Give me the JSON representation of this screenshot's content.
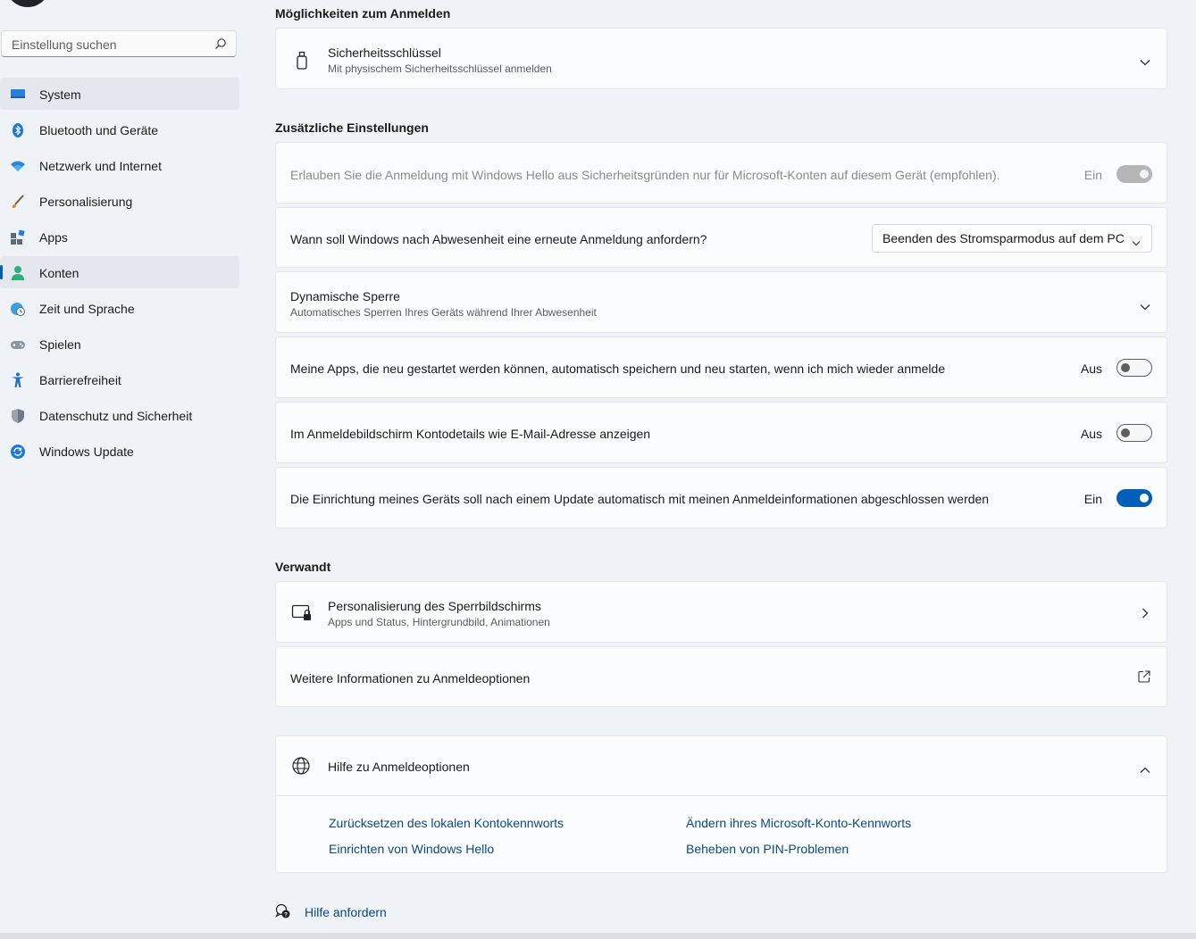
{
  "search": {
    "placeholder": "Einstellung suchen"
  },
  "sidebar": {
    "items": [
      {
        "label": "System",
        "icon": "monitor-icon"
      },
      {
        "label": "Bluetooth und Geräte",
        "icon": "bluetooth-icon"
      },
      {
        "label": "Netzwerk und Internet",
        "icon": "wifi-icon"
      },
      {
        "label": "Personalisierung",
        "icon": "brush-icon"
      },
      {
        "label": "Apps",
        "icon": "apps-icon"
      },
      {
        "label": "Konten",
        "icon": "person-icon"
      },
      {
        "label": "Zeit und Sprache",
        "icon": "globe-clock-icon"
      },
      {
        "label": "Spielen",
        "icon": "gamepad-icon"
      },
      {
        "label": "Barrierefreiheit",
        "icon": "accessibility-icon"
      },
      {
        "label": "Datenschutz und Sicherheit",
        "icon": "shield-icon"
      },
      {
        "label": "Windows Update",
        "icon": "update-icon"
      }
    ]
  },
  "signin_options": {
    "heading": "Möglichkeiten zum Anmelden",
    "security_key": {
      "title": "Sicherheitsschlüssel",
      "subtitle": "Mit physischem Sicherheitsschlüssel anmelden"
    }
  },
  "additional": {
    "heading": "Zusätzliche Einstellungen",
    "hello_only": {
      "text": "Erlauben Sie die Anmeldung mit Windows Hello aus Sicherheitsgründen nur für Microsoft-Konten auf diesem Gerät (empfohlen).",
      "state": "Ein",
      "enabled": false
    },
    "reauth": {
      "text": "Wann soll Windows nach Abwesenheit eine erneute Anmeldung anfordern?",
      "value": "Beenden des Stromsparmodus auf dem PC"
    },
    "dynamic_lock": {
      "title": "Dynamische Sperre",
      "subtitle": "Automatisches Sperren Ihres Geräts während Ihrer Abwesenheit"
    },
    "restart_apps": {
      "text": "Meine Apps, die neu gestartet werden können, automatisch speichern und neu starten, wenn ich mich wieder anmelde",
      "state": "Aus"
    },
    "account_details": {
      "text": "Im Anmeldebildschirm Kontodetails wie E-Mail-Adresse anzeigen",
      "state": "Aus"
    },
    "finish_setup": {
      "text": "Die Einrichtung meines Geräts soll nach einem Update automatisch mit meinen Anmeldeinformationen abgeschlossen werden",
      "state": "Ein"
    }
  },
  "related": {
    "heading": "Verwandt",
    "lockscreen": {
      "title": "Personalisierung des Sperrbildschirms",
      "subtitle": "Apps und Status, Hintergrundbild, Animationen"
    },
    "more_info": {
      "text": "Weitere Informationen zu Anmeldeoptionen"
    }
  },
  "help": {
    "title": "Hilfe zu Anmeldeoptionen",
    "links": [
      "Zurücksetzen des lokalen Kontokennworts",
      "Ändern ihres Microsoft-Konto-Kennworts",
      "Einrichten von Windows Hello",
      "Beheben von PIN-Problemen"
    ]
  },
  "get_help": "Hilfe anfordern",
  "colors": {
    "accent": "#005fb8",
    "link": "#0a4a86",
    "background": "#eff3f8",
    "card": "#fbfcfd"
  }
}
